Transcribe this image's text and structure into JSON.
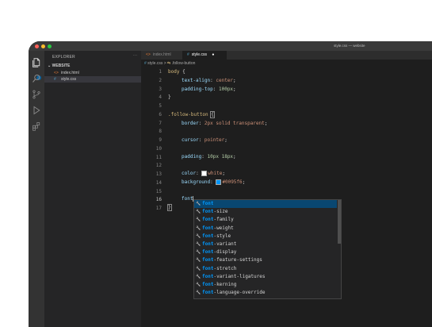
{
  "window": {
    "title": "style.css — website",
    "traffic_lights": [
      "#ff5f57",
      "#febc2e",
      "#28c840"
    ]
  },
  "activity_bar": {
    "icons": [
      "files-icon",
      "search-icon",
      "source-control-icon",
      "debug-icon",
      "extensions-icon"
    ]
  },
  "sidebar": {
    "title": "EXPLORER",
    "more": "···",
    "folder": "WEBSITE",
    "files": [
      {
        "icon": "<>",
        "name": "index.html",
        "icon_color": "#e37933"
      },
      {
        "icon": "#",
        "name": "style.css",
        "icon_color": "#519aba"
      }
    ]
  },
  "tabs": [
    {
      "icon": "<>",
      "label": "index.html",
      "icon_color": "#e37933"
    },
    {
      "icon": "#",
      "label": "style.css",
      "icon_color": "#519aba",
      "dirty": "●"
    }
  ],
  "breadcrumb": {
    "file_icon": "#",
    "file": "style.css",
    "sep": ">",
    "sym_icon": "⇆",
    "symbol": ".follow-button"
  },
  "editor": {
    "line_numbers": [
      "1",
      "2",
      "3",
      "4",
      "5",
      "6",
      "7",
      "8",
      "9",
      "10",
      "11",
      "12",
      "13",
      "14",
      "15",
      "16",
      "17"
    ],
    "current_line": "16",
    "code": {
      "l1_sel": "body",
      "l1_brace": " {",
      "l2_prop": "text-align",
      "l2_val": "center",
      "l3_prop": "padding-top",
      "l3_val": "100px",
      "l4": "}",
      "l6_sel": ".follow-button",
      "l6_brace": "{",
      "l7_prop": "border",
      "l7_val": "2px solid transparent",
      "l9_prop": "cursor",
      "l9_val": "pointer",
      "l11_prop": "padding",
      "l11_val": "10px 18px",
      "l13_prop": "color",
      "l13_val": "white",
      "l13_swatch": "#ffffff",
      "l14_prop": "background",
      "l14_val": "#0095f6",
      "l14_swatch": "#0095f6",
      "l16_typed": "font",
      "l17": "}"
    }
  },
  "suggestions": {
    "typed": "font",
    "items": [
      {
        "match": "font",
        "rest": ""
      },
      {
        "match": "font",
        "rest": "-size"
      },
      {
        "match": "font",
        "rest": "-family"
      },
      {
        "match": "font",
        "rest": "-weight"
      },
      {
        "match": "font",
        "rest": "-style"
      },
      {
        "match": "font",
        "rest": "-variant"
      },
      {
        "match": "font",
        "rest": "-display"
      },
      {
        "match": "font",
        "rest": "-feature-settings"
      },
      {
        "match": "font",
        "rest": "-stretch"
      },
      {
        "match": "font",
        "rest": "-variant-ligatures"
      },
      {
        "match": "font",
        "rest": "-kerning"
      },
      {
        "match": "font",
        "rest": "-language-override"
      }
    ]
  }
}
